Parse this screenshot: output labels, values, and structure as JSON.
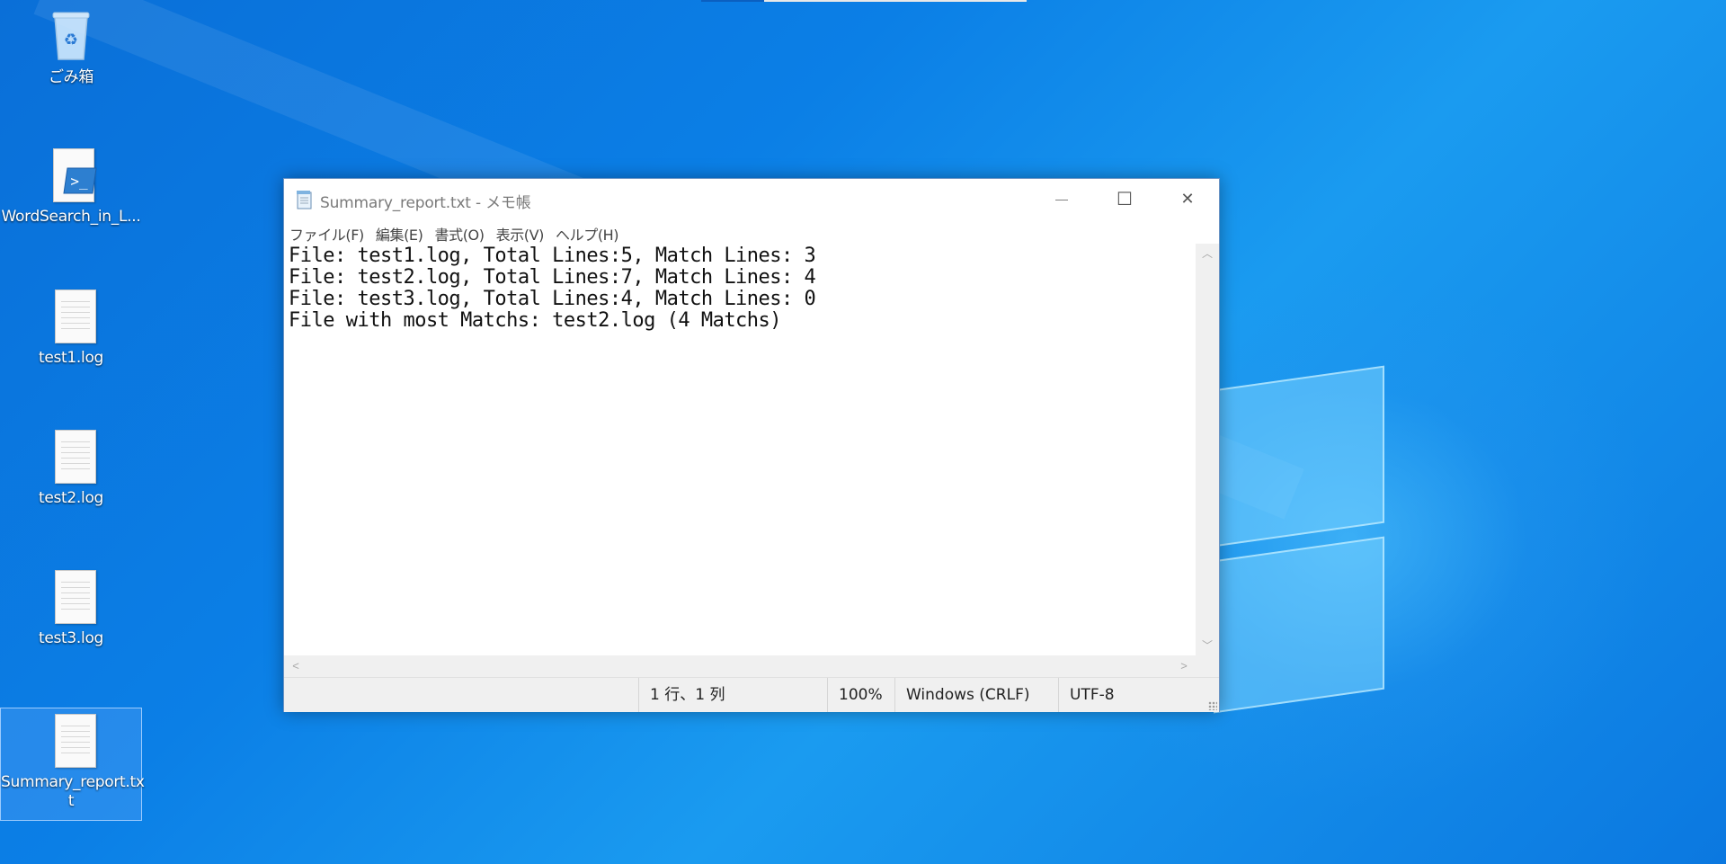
{
  "desktop": {
    "icons": [
      {
        "label": "ごみ箱",
        "icon": "recycle-bin-icon"
      },
      {
        "label": "WordSearch_in_L...",
        "icon": "powershell-script-icon"
      },
      {
        "label": "test1.log",
        "icon": "text-file-icon"
      },
      {
        "label": "test2.log",
        "icon": "text-file-icon"
      },
      {
        "label": "test3.log",
        "icon": "text-file-icon"
      },
      {
        "label": "Summary_report.tx\nt",
        "icon": "text-file-icon"
      }
    ]
  },
  "notepad": {
    "title": "Summary_report.txt - メモ帳",
    "menu": [
      "ファイル(F)",
      "編集(E)",
      "書式(O)",
      "表示(V)",
      "ヘルプ(H)"
    ],
    "content_lines": [
      "File: test1.log, Total Lines:5, Match Lines: 3",
      "File: test2.log, Total Lines:7, Match Lines: 4",
      "File: test3.log, Total Lines:4, Match Lines: 0",
      "File with most Matchs: test2.log (4 Matchs)"
    ],
    "status": {
      "position": "1 行、1 列",
      "zoom": "100%",
      "line_ending": "Windows (CRLF)",
      "encoding": "UTF-8"
    },
    "controls": {
      "minimize": "—",
      "maximize": "☐",
      "close": "✕"
    }
  },
  "colors": {
    "desktop_bg": "#0b7fe6",
    "window_border": "#6c94c4",
    "statusbar_bg": "#f0f0f0"
  }
}
